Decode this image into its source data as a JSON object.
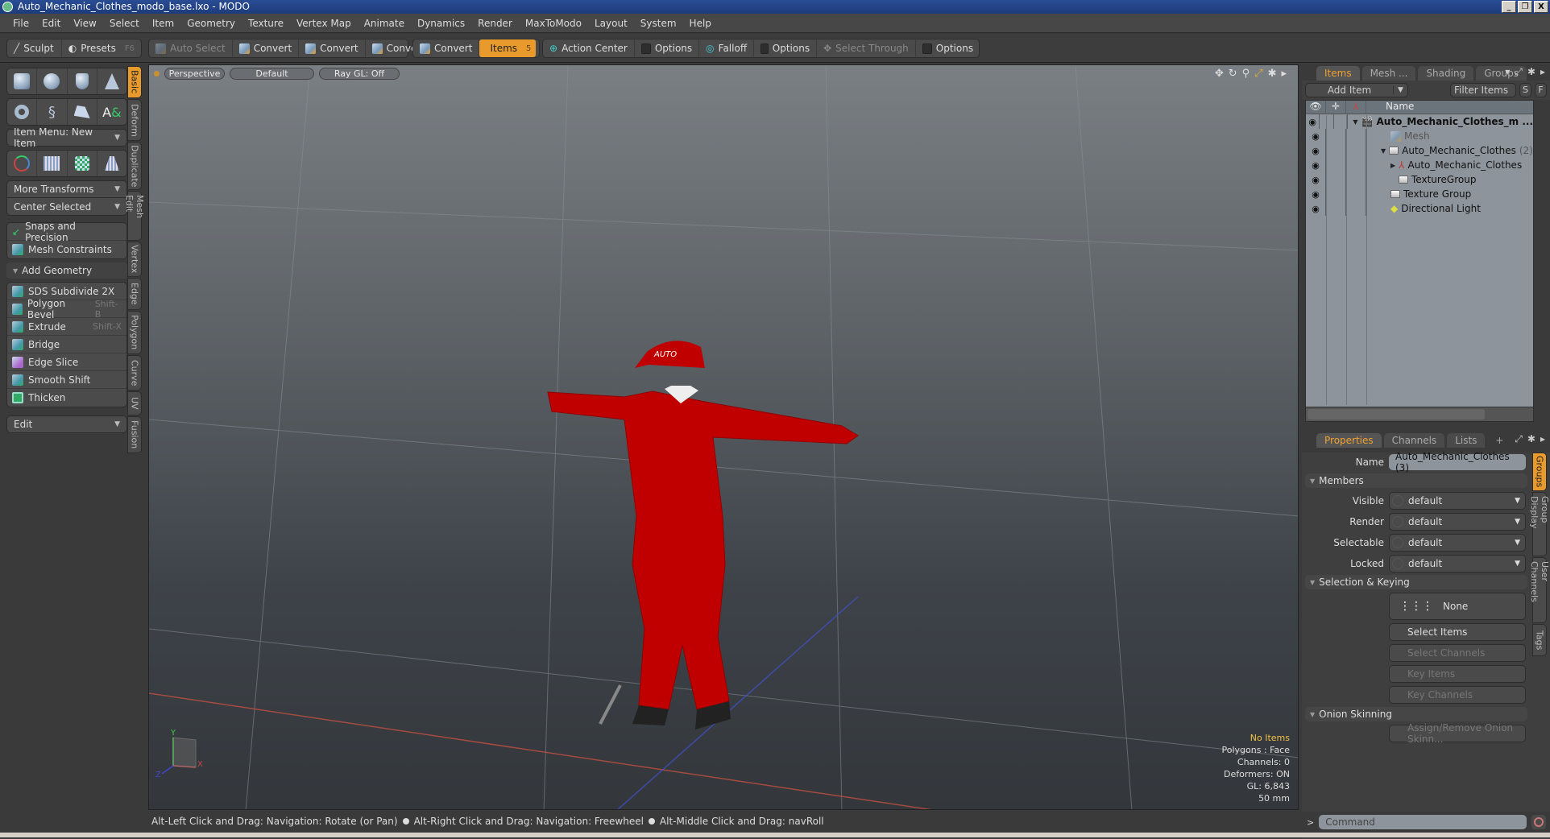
{
  "window": {
    "title": "Auto_Mechanic_Clothes_modo_base.lxo - MODO",
    "controls": [
      "_",
      "❐",
      "X"
    ]
  },
  "menu": [
    "File",
    "Edit",
    "View",
    "Select",
    "Item",
    "Geometry",
    "Texture",
    "Vertex Map",
    "Animate",
    "Dynamics",
    "Render",
    "MaxToModo",
    "Layout",
    "System",
    "Help"
  ],
  "toolbar": {
    "sculpt": "Sculpt",
    "presets": "Presets",
    "presets_key": "F6",
    "auto_select": "Auto Select",
    "convert1": "Convert",
    "convert2": "Convert",
    "convert3": "Convert",
    "convert4": "Convert",
    "items": "Items",
    "items_key": "5",
    "action_center": "Action Center",
    "options1": "Options",
    "falloff": "Falloff",
    "options2": "Options",
    "select_through": "Select Through",
    "options3": "Options"
  },
  "left_panel": {
    "item_menu": "Item Menu: New Item",
    "more_transforms": "More Transforms",
    "center_selected": "Center Selected",
    "snaps": "Snaps and Precision",
    "mesh_constraints": "Mesh Constraints",
    "add_geometry": "Add Geometry",
    "tools": [
      {
        "label": "SDS Subdivide 2X",
        "key": ""
      },
      {
        "label": "Polygon Bevel",
        "key": "Shift-B"
      },
      {
        "label": "Extrude",
        "key": "Shift-X"
      },
      {
        "label": "Bridge",
        "key": ""
      },
      {
        "label": "Edge Slice",
        "key": ""
      },
      {
        "label": "Smooth Shift",
        "key": ""
      },
      {
        "label": "Thicken",
        "key": ""
      }
    ],
    "edit": "Edit",
    "vtabs": [
      "Basic",
      "Deform",
      "Duplicate",
      "Mesh Edit",
      "Vertex",
      "Edge",
      "Polygon",
      "Curve",
      "UV",
      "Fusion"
    ]
  },
  "viewport": {
    "view": "Perspective",
    "shading": "Default",
    "raygl": "Ray GL: Off",
    "stats": {
      "selection": "No Items",
      "polygons": "Polygons : Face",
      "channels": "Channels: 0",
      "deformers": "Deformers: ON",
      "gl": "GL: 6,843",
      "lens": "50 mm"
    },
    "axis": {
      "x": "X",
      "y": "Y",
      "z": "Z"
    },
    "cap_text": "AUTO"
  },
  "status": {
    "hint1": "Alt-Left Click and Drag: Navigation: Rotate (or Pan)",
    "hint2": "Alt-Right Click and Drag: Navigation: Freewheel",
    "hint3": "Alt-Middle Click and Drag: navRoll"
  },
  "items_panel": {
    "tabs": [
      "Items",
      "Mesh ...",
      "Shading",
      "Groups"
    ],
    "add_item": "Add Item",
    "filter": "Filter Items",
    "s": "S",
    "f": "F",
    "col_name": "Name",
    "rows": [
      {
        "name": "Auto_Mechanic_Clothes_m ...",
        "count": ""
      },
      {
        "name": "Mesh",
        "count": ""
      },
      {
        "name": "Auto_Mechanic_Clothes",
        "count": "(2)"
      },
      {
        "name": "Auto_Mechanic_Clothes",
        "count": ""
      },
      {
        "name": "TextureGroup",
        "count": ""
      },
      {
        "name": "Texture Group",
        "count": ""
      },
      {
        "name": "Directional Light",
        "count": ""
      }
    ]
  },
  "properties": {
    "tabs": [
      "Properties",
      "Channels",
      "Lists",
      "+"
    ],
    "name_label": "Name",
    "name_value": "Auto_Mechanic_Clothes (3)",
    "members": "Members",
    "visible_label": "Visible",
    "visible": "default",
    "render_label": "Render",
    "render": "default",
    "selectable_label": "Selectable",
    "selectable": "default",
    "locked_label": "Locked",
    "locked": "default",
    "sel_keying": "Selection & Keying",
    "none": "None",
    "select_items": "Select Items",
    "select_channels": "Select Channels",
    "key_items": "Key Items",
    "key_channels": "Key Channels",
    "onion": "Onion Skinning",
    "assign_onion": "Assign/Remove Onion Skinn...",
    "vtabs": [
      "Groups",
      "Group Display",
      "User Channels",
      "Tags"
    ]
  },
  "command": {
    "prompt": ">",
    "placeholder": "Command"
  }
}
